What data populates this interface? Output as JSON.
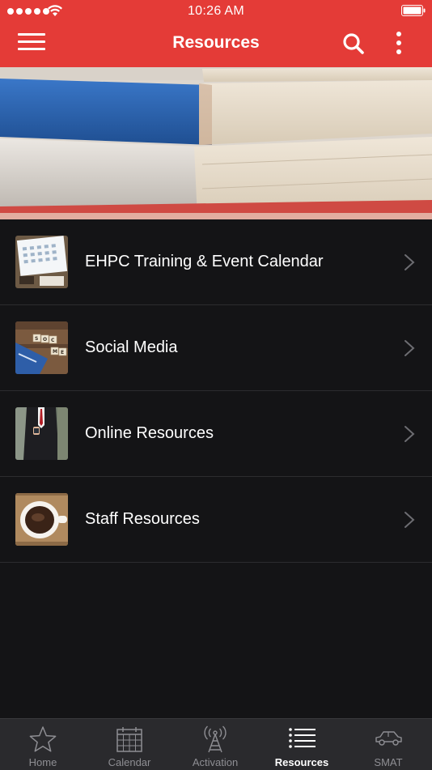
{
  "status_bar": {
    "time": "10:26 AM"
  },
  "header": {
    "title": "Resources"
  },
  "list": {
    "items": [
      {
        "label": "EHPC Training & Event Calendar"
      },
      {
        "label": "Social Media"
      },
      {
        "label": "Online Resources"
      },
      {
        "label": "Staff Resources"
      }
    ]
  },
  "tabbar": {
    "tabs": [
      {
        "label": "Home",
        "icon": "star-icon"
      },
      {
        "label": "Calendar",
        "icon": "calendar-icon"
      },
      {
        "label": "Activation",
        "icon": "antenna-icon"
      },
      {
        "label": "Resources",
        "icon": "list-icon",
        "active": true
      },
      {
        "label": "SMAT",
        "icon": "car-icon"
      }
    ]
  },
  "colors": {
    "accent": "#e43b37",
    "background": "#141416",
    "tabbar": "#2a2a2d",
    "inactive_tab": "#8e8e93"
  }
}
